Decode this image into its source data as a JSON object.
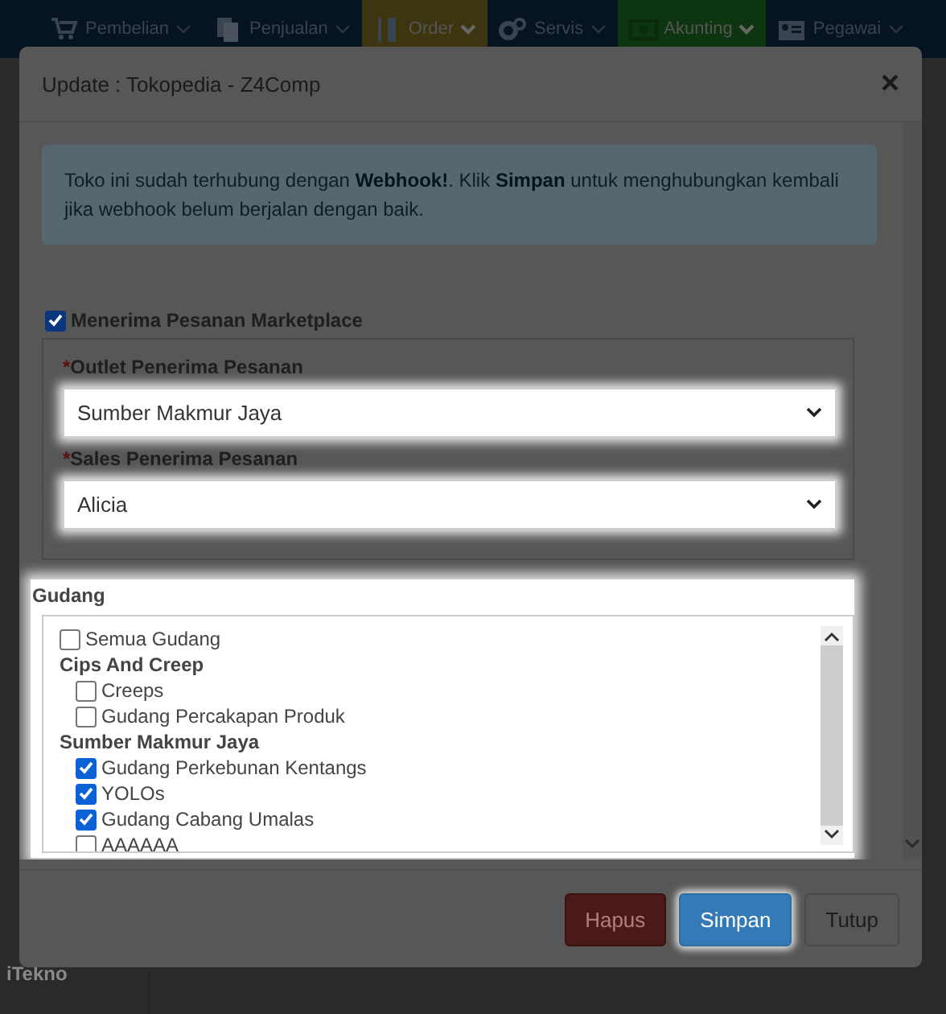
{
  "nav": {
    "items": [
      {
        "label": "Pembelian"
      },
      {
        "label": "Penjualan"
      },
      {
        "label": "Order",
        "color": "#3d3510"
      },
      {
        "label": "Servis"
      },
      {
        "label": "Akunting",
        "color": "#0d3510"
      },
      {
        "label": "Pegawai"
      }
    ]
  },
  "background": {
    "footer_text": "iTekno"
  },
  "modal": {
    "title": "Update : Tokopedia - Z4Comp",
    "close": "×",
    "alert": "Toko ini sudah terhubung dengan **Webhook!**. Klik **Simpan** untuk menghubungkan kembali jika webhook belum berjalan dengan baik.",
    "accept": {
      "label": "Menerima Pesanan Marketplace",
      "checked": true
    },
    "fields": [
      {
        "mark": "*",
        "label": "Outlet Penerima Pesanan",
        "value": "Sumber Makmur Jaya",
        "highlighted": true
      },
      {
        "mark": "*",
        "label": "Sales Penerima Pesanan",
        "value": "Alicia",
        "highlighted": true
      }
    ],
    "warehouse": {
      "title": "Gudang",
      "highlighted": true,
      "items": [
        {
          "kind": "check",
          "label": "Semua Gudang",
          "checked": false
        },
        {
          "kind": "group",
          "label": "Cips And Creep",
          "children": [
            {
              "kind": "check",
              "label": "Creeps",
              "checked": false
            },
            {
              "kind": "check",
              "label": "Gudang Percakapan Produk",
              "checked": false
            }
          ]
        },
        {
          "kind": "group",
          "label": "Sumber Makmur Jaya",
          "children": [
            {
              "kind": "check",
              "label": "Gudang Perkebunan Kentangs",
              "checked": true
            },
            {
              "kind": "check",
              "label": "YOLOs",
              "checked": true
            },
            {
              "kind": "check",
              "label": "Gudang Cabang Umalas",
              "checked": true
            },
            {
              "kind": "check",
              "label": "AAAAAA",
              "checked": false
            }
          ]
        }
      ]
    },
    "buttons": [
      {
        "label": "Hapus",
        "kind": "danger",
        "highlighted": false
      },
      {
        "label": "Simpan",
        "kind": "primary",
        "highlighted": true
      },
      {
        "label": "Tutup",
        "kind": "default",
        "highlighted": false
      }
    ]
  }
}
